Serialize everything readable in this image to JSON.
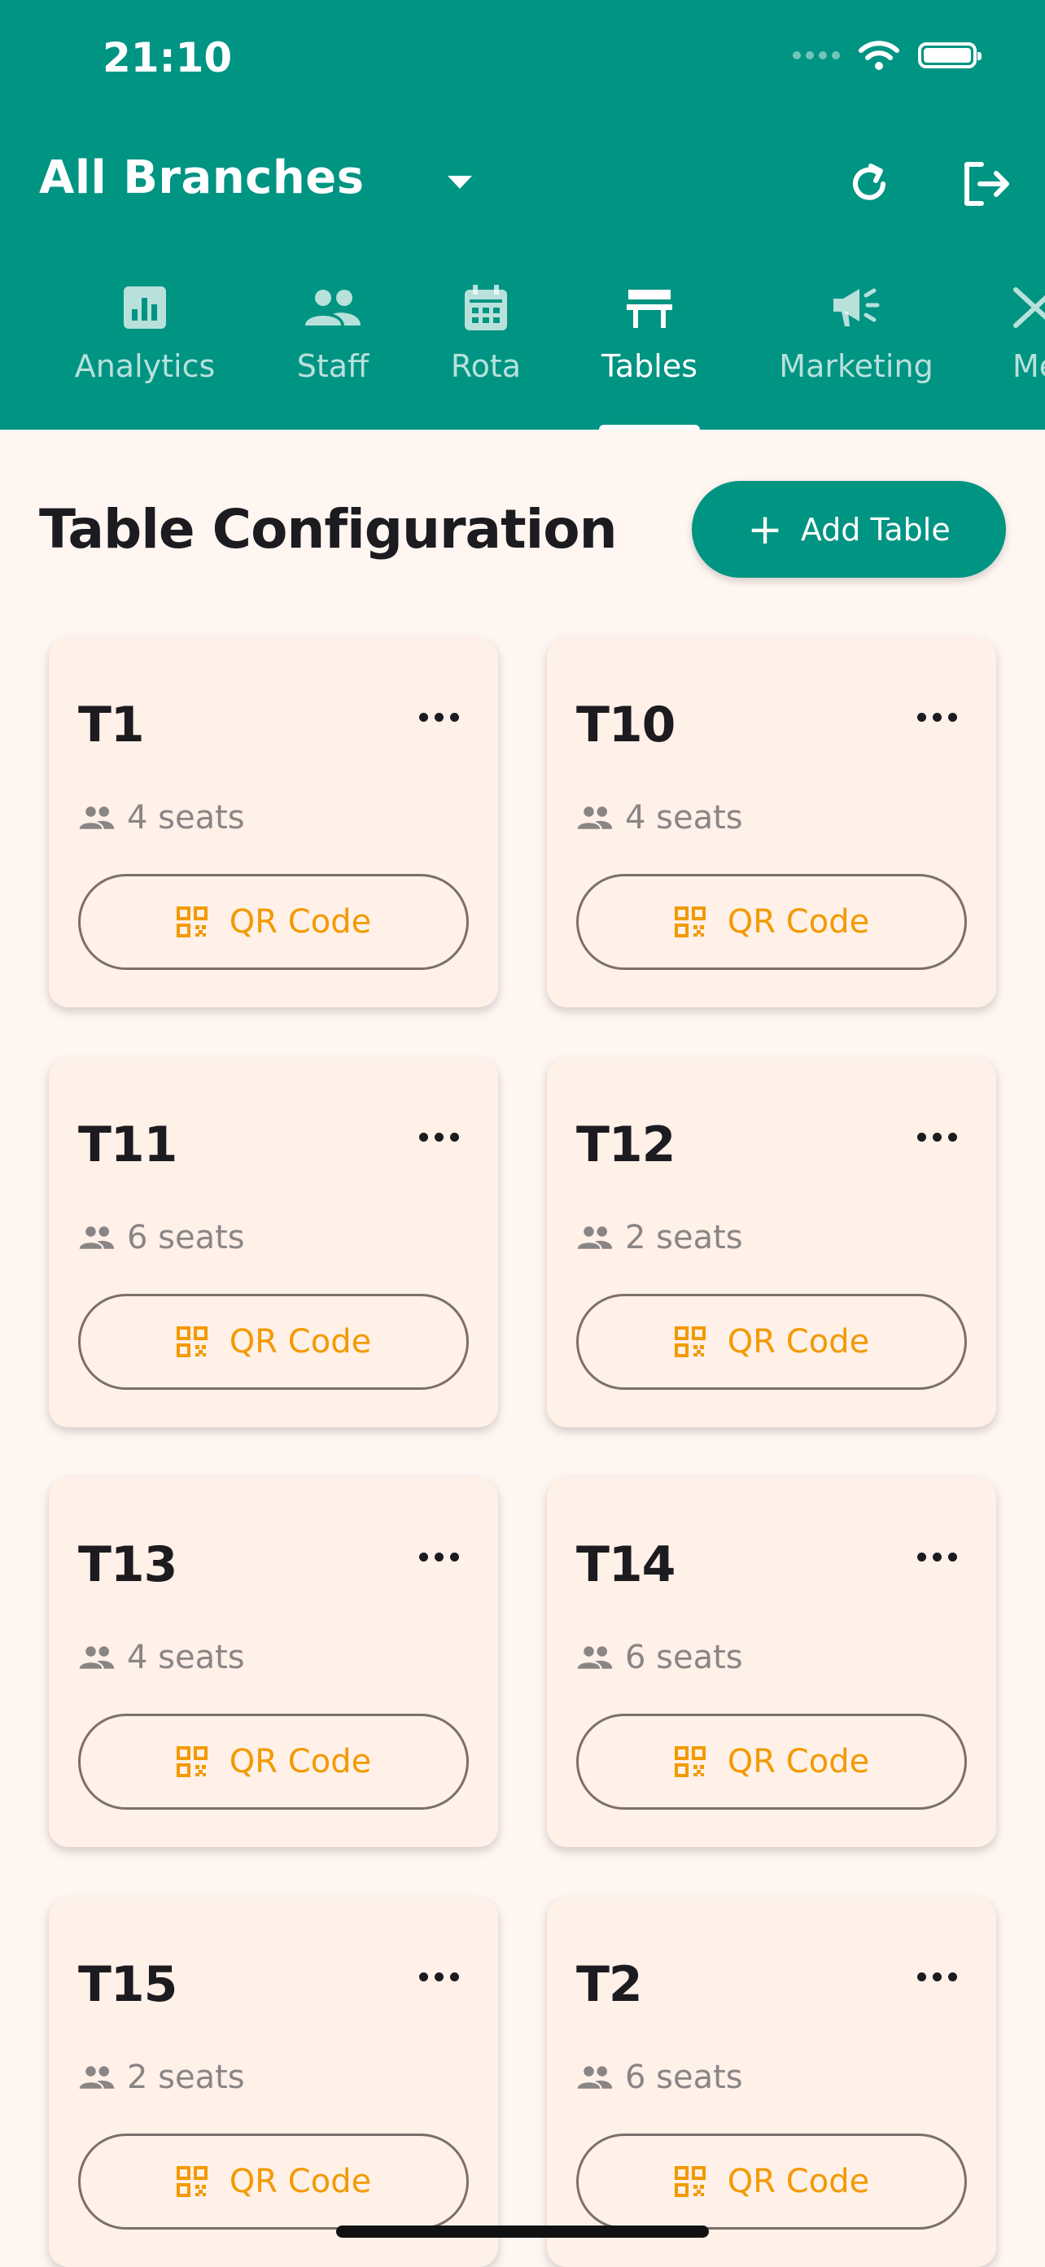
{
  "status_bar": {
    "time": "21:10"
  },
  "header": {
    "branch_selector": "All Branches",
    "tabs": [
      {
        "label": "Analytics",
        "icon": "analytics-icon",
        "active": false
      },
      {
        "label": "Staff",
        "icon": "people-icon",
        "active": false
      },
      {
        "label": "Rota",
        "icon": "calendar-icon",
        "active": false
      },
      {
        "label": "Tables",
        "icon": "table-icon",
        "active": true
      },
      {
        "label": "Marketing",
        "icon": "megaphone-icon",
        "active": false
      },
      {
        "label": "Me",
        "icon": "menu-icon",
        "active": false
      }
    ]
  },
  "main": {
    "title": "Table Configuration",
    "add_button_label": "Add Table",
    "tables": [
      {
        "name": "T1",
        "seats": "4 seats",
        "qr_label": "QR Code"
      },
      {
        "name": "T10",
        "seats": "4 seats",
        "qr_label": "QR Code"
      },
      {
        "name": "T11",
        "seats": "6 seats",
        "qr_label": "QR Code"
      },
      {
        "name": "T12",
        "seats": "2 seats",
        "qr_label": "QR Code"
      },
      {
        "name": "T13",
        "seats": "4 seats",
        "qr_label": "QR Code"
      },
      {
        "name": "T14",
        "seats": "6 seats",
        "qr_label": "QR Code"
      },
      {
        "name": "T15",
        "seats": "2 seats",
        "qr_label": "QR Code"
      },
      {
        "name": "T2",
        "seats": "6 seats",
        "qr_label": "QR Code"
      }
    ]
  },
  "colors": {
    "primary": "#009483",
    "background": "#FFF6F2",
    "card": "#FFF0E8",
    "qr_accent": "#F29A00"
  }
}
